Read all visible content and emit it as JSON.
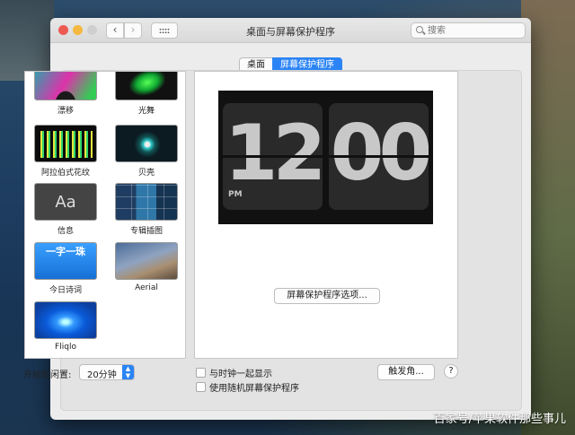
{
  "window": {
    "title": "桌面与屏幕保护程序",
    "search_placeholder": "搜索",
    "back_icon": "‹",
    "forward_icon": "›"
  },
  "tabs": [
    {
      "label": "桌面",
      "active": false
    },
    {
      "label": "屏幕保护程序",
      "active": true
    }
  ],
  "screensavers": [
    {
      "label": "漂移"
    },
    {
      "label": "光舞"
    },
    {
      "label": "阿拉伯式花纹"
    },
    {
      "label": "贝壳"
    },
    {
      "label": "信息",
      "thumb_text": "Aa"
    },
    {
      "label": "专辑插图"
    },
    {
      "label": "今日诗词",
      "thumb_text": "一字一珠"
    },
    {
      "label": "Aerial"
    },
    {
      "label": "Fliqlo",
      "selected": true
    }
  ],
  "preview": {
    "hours": "12",
    "minutes": "00",
    "ampm": "PM",
    "options_button": "屏幕保护程序选项..."
  },
  "footer": {
    "idle_label": "开始前闲置:",
    "idle_value": "20分钟",
    "show_clock": "与时钟一起显示",
    "random": "使用随机屏幕保护程序",
    "hot_corners": "触发角...",
    "help": "?"
  },
  "watermark": "百家号/苹果软件那些事儿",
  "colors": {
    "accent": "#2b84f5"
  }
}
